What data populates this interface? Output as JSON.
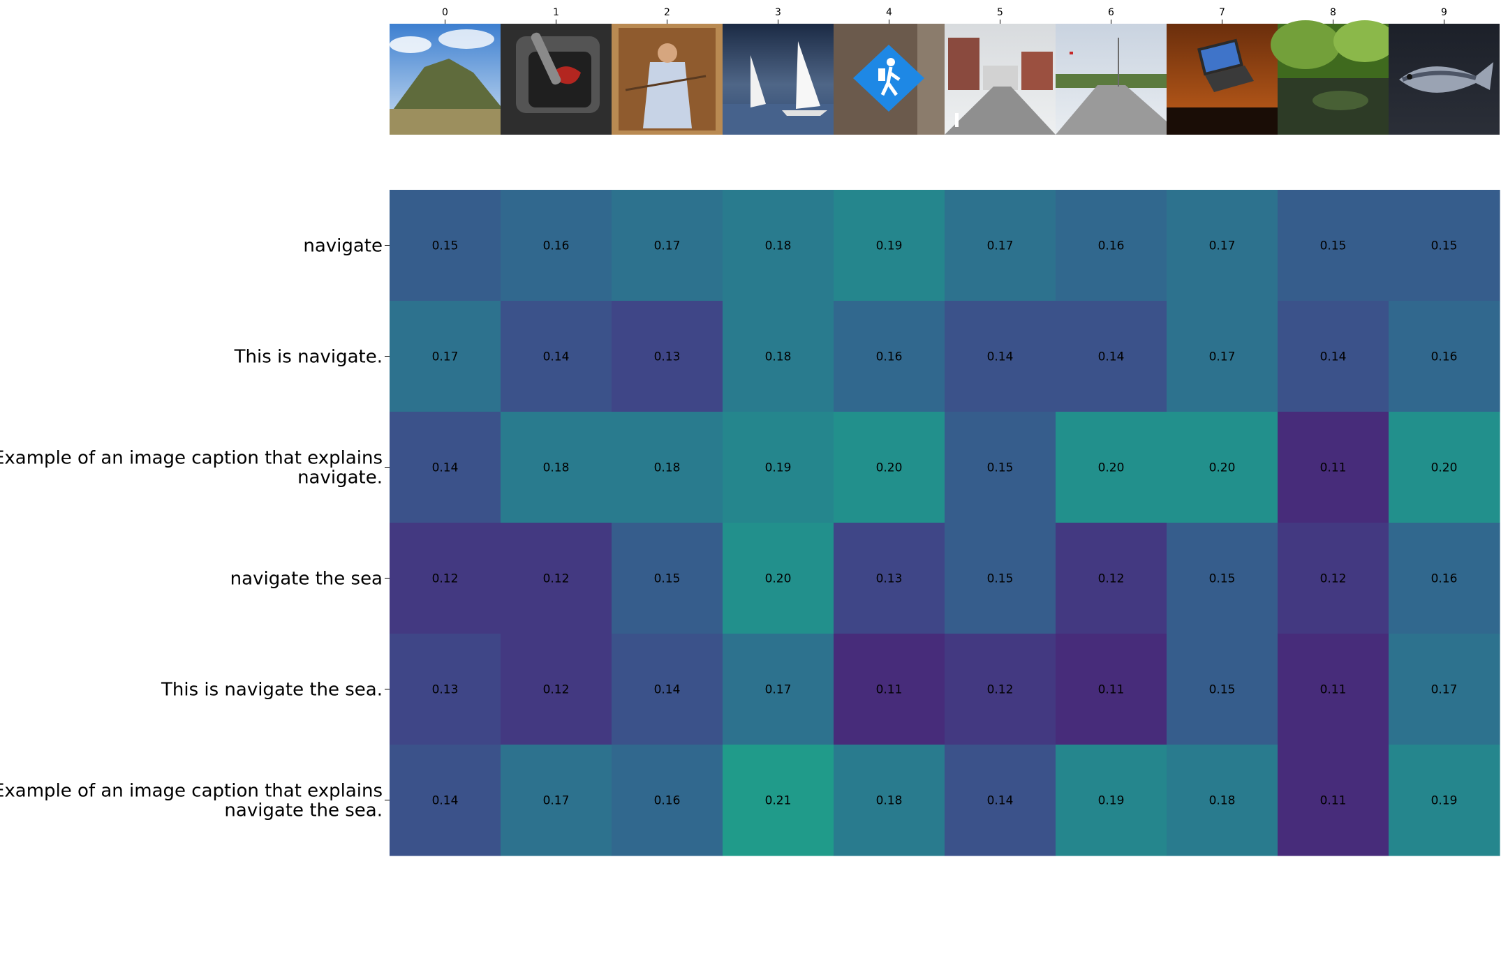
{
  "chart_data": {
    "type": "heatmap",
    "title": "",
    "xlabel": "",
    "ylabel": "",
    "columns": [
      "0",
      "1",
      "2",
      "3",
      "4",
      "5",
      "6",
      "7",
      "8",
      "9"
    ],
    "column_images": [
      "hill-under-blue-sky-photo",
      "car-gear-shift-photo",
      "painting-of-figure-in-robe-photo",
      "sailboats-on-sea-photo",
      "blue-hiker-sign-on-tree-photo",
      "town-street-photo",
      "suburban-road-photo",
      "laptop-on-desk-photo",
      "river-with-trees-photo",
      "fish-on-ground-photo"
    ],
    "rows": [
      [
        "navigate"
      ],
      [
        "This is navigate."
      ],
      [
        "Example of an image caption that explains",
        "navigate."
      ],
      [
        "navigate the sea"
      ],
      [
        "This is navigate the sea."
      ],
      [
        "Example of an image caption that explains",
        "navigate the sea."
      ]
    ],
    "values": [
      [
        "0.15",
        "0.16",
        "0.17",
        "0.18",
        "0.19",
        "0.17",
        "0.16",
        "0.17",
        "0.15",
        "0.15"
      ],
      [
        "0.17",
        "0.14",
        "0.13",
        "0.18",
        "0.16",
        "0.14",
        "0.14",
        "0.17",
        "0.14",
        "0.16"
      ],
      [
        "0.14",
        "0.18",
        "0.18",
        "0.19",
        "0.20",
        "0.15",
        "0.20",
        "0.20",
        "0.11",
        "0.20"
      ],
      [
        "0.12",
        "0.12",
        "0.15",
        "0.20",
        "0.13",
        "0.15",
        "0.12",
        "0.15",
        "0.12",
        "0.16"
      ],
      [
        "0.13",
        "0.12",
        "0.14",
        "0.17",
        "0.11",
        "0.12",
        "0.11",
        "0.15",
        "0.11",
        "0.17"
      ],
      [
        "0.14",
        "0.17",
        "0.16",
        "0.21",
        "0.18",
        "0.14",
        "0.19",
        "0.18",
        "0.11",
        "0.19"
      ]
    ],
    "colormap": "viridis",
    "color_range": [
      0.08,
      0.32
    ],
    "grid": false,
    "legend": "none"
  }
}
